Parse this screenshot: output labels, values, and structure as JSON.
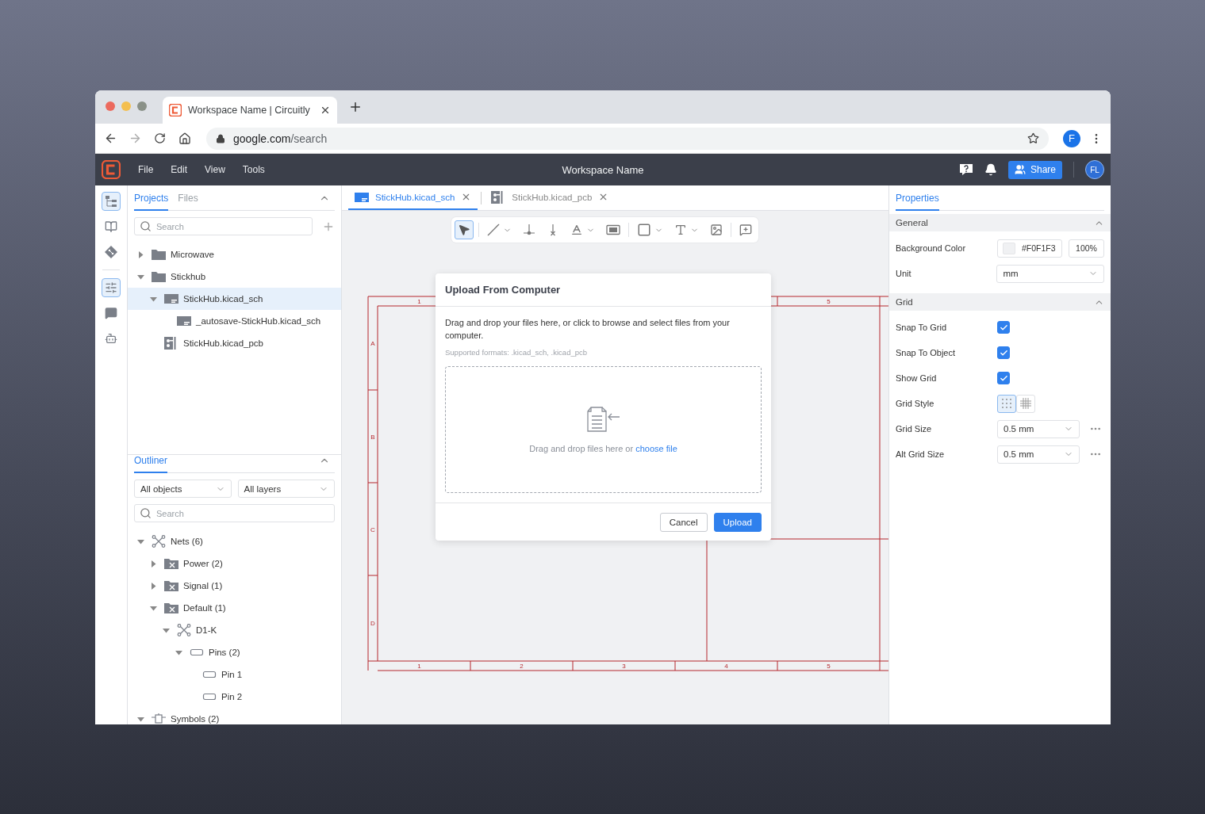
{
  "browser": {
    "tab_title": "Workspace Name | Circuitly",
    "url_host": "google.com",
    "url_path": "/search",
    "profile": "F"
  },
  "app": {
    "menu": [
      "File",
      "Edit",
      "View",
      "Tools"
    ],
    "workspace": "Workspace Name",
    "share": "Share",
    "avatar": "FL"
  },
  "rail": [
    {
      "kind": "tree",
      "selected": true
    },
    {
      "kind": "library",
      "selected": false
    },
    {
      "kind": "git",
      "selected": false
    },
    {
      "kind": "properties",
      "selected": true
    },
    {
      "kind": "comments",
      "selected": false
    },
    {
      "kind": "assistant",
      "selected": false
    }
  ],
  "projects": {
    "tabs": [
      {
        "label": "Projects",
        "selected": true
      },
      {
        "label": "Files",
        "selected": false
      }
    ],
    "search": {
      "placeholder": "Search"
    },
    "tree": [
      {
        "label": "Microwave",
        "kind": "folder",
        "expanded": false,
        "selected": false
      },
      {
        "label": "Stickhub",
        "kind": "folder",
        "expanded": true,
        "selected": false,
        "children": [
          {
            "label": "StickHub.kicad_sch",
            "kind": "sch",
            "expanded": true,
            "selected": true,
            "children": [
              {
                "label": "_autosave-StickHub.kicad_sch",
                "kind": "sch",
                "selected": false
              }
            ]
          },
          {
            "label": "StickHub.kicad_pcb",
            "kind": "pcb",
            "selected": false
          }
        ]
      }
    ]
  },
  "outliner": {
    "tabs": [
      {
        "label": "Outliner",
        "selected": true
      }
    ],
    "filters": [
      "All objects",
      "All layers"
    ],
    "search": {
      "placeholder": "Search"
    },
    "tree": [
      {
        "label": "Nets (6)",
        "kind": "net",
        "expanded": true,
        "selected": false,
        "children": [
          {
            "label": "Power (2)",
            "kind": "netclass",
            "expanded": false,
            "selected": false
          },
          {
            "label": "Signal (1)",
            "kind": "netclass",
            "expanded": false,
            "selected": false
          },
          {
            "label": "Default (1)",
            "kind": "netclass",
            "expanded": true,
            "selected": false,
            "children": [
              {
                "label": "D1-K",
                "kind": "net",
                "expanded": true,
                "selected": false,
                "children": [
                  {
                    "label": "Pins (2)",
                    "kind": "pin",
                    "expanded": true,
                    "selected": false,
                    "children": [
                      {
                        "label": "Pin 1",
                        "kind": "pin",
                        "selected": false
                      },
                      {
                        "label": "Pin 2",
                        "kind": "pin",
                        "selected": false
                      }
                    ]
                  }
                ]
              }
            ]
          }
        ]
      },
      {
        "label": "Symbols (2)",
        "kind": "symbol",
        "expanded": true,
        "selected": false
      }
    ]
  },
  "editor": {
    "tabs": [
      {
        "label": "StickHub.kicad_sch",
        "kind": "sch",
        "selected": true
      },
      {
        "label": "StickHub.kicad_pcb",
        "kind": "pcb",
        "selected": false
      }
    ],
    "tools": [
      {
        "kind": "select",
        "selected": true
      },
      {
        "kind": "line",
        "selected": false,
        "dropdown": true
      },
      {
        "kind": "junction",
        "selected": false
      },
      {
        "kind": "no-connect",
        "selected": false
      },
      {
        "kind": "label",
        "selected": false,
        "dropdown": true
      },
      {
        "kind": "sheet",
        "selected": false
      },
      {
        "kind": "rectangle",
        "selected": false,
        "dropdown": true
      },
      {
        "kind": "text",
        "selected": false,
        "dropdown": true
      },
      {
        "kind": "image",
        "selected": false
      },
      {
        "kind": "comment",
        "selected": false
      }
    ],
    "sheet": {
      "top_zones": [
        "1",
        "5"
      ],
      "bottom_zones": [
        "1",
        "2",
        "3",
        "4",
        "5"
      ],
      "row_zones": [
        "A",
        "B",
        "C",
        "D"
      ]
    }
  },
  "dialog": {
    "title": "Upload From Computer",
    "description": "Drag and drop your files here, or click to browse and select files from your computer.",
    "formats": "Supported formats: .kicad_sch, .kicad_pcb",
    "drop_text": "Drag and drop files here or",
    "drop_link": "choose file",
    "buttons": [
      {
        "label": "Cancel",
        "kind": "secondary"
      },
      {
        "label": "Upload",
        "kind": "primary"
      }
    ]
  },
  "properties": {
    "tabs": [
      {
        "label": "Properties",
        "selected": true
      }
    ],
    "sections": [
      {
        "title": "General",
        "expanded": true,
        "rows": [
          {
            "kind": "color",
            "label": "Background Color",
            "value": "#F0F1F3",
            "opacity": "100%"
          },
          {
            "kind": "select",
            "label": "Unit",
            "value": "mm"
          }
        ]
      },
      {
        "title": "Grid",
        "expanded": true,
        "rows": [
          {
            "kind": "checkbox",
            "label": "Snap To Grid",
            "checked": true
          },
          {
            "kind": "checkbox",
            "label": "Snap To Object",
            "checked": true
          },
          {
            "kind": "checkbox",
            "label": "Show Grid",
            "checked": true
          },
          {
            "kind": "grid-style",
            "label": "Grid Style",
            "options": [
              {
                "kind": "dots",
                "selected": true
              },
              {
                "kind": "lines",
                "selected": false
              }
            ]
          },
          {
            "kind": "select",
            "label": "Grid Size",
            "value": "0.5 mm",
            "more": true
          },
          {
            "kind": "select",
            "label": "Alt Grid Size",
            "value": "0.5 mm",
            "more": true
          }
        ]
      }
    ]
  }
}
